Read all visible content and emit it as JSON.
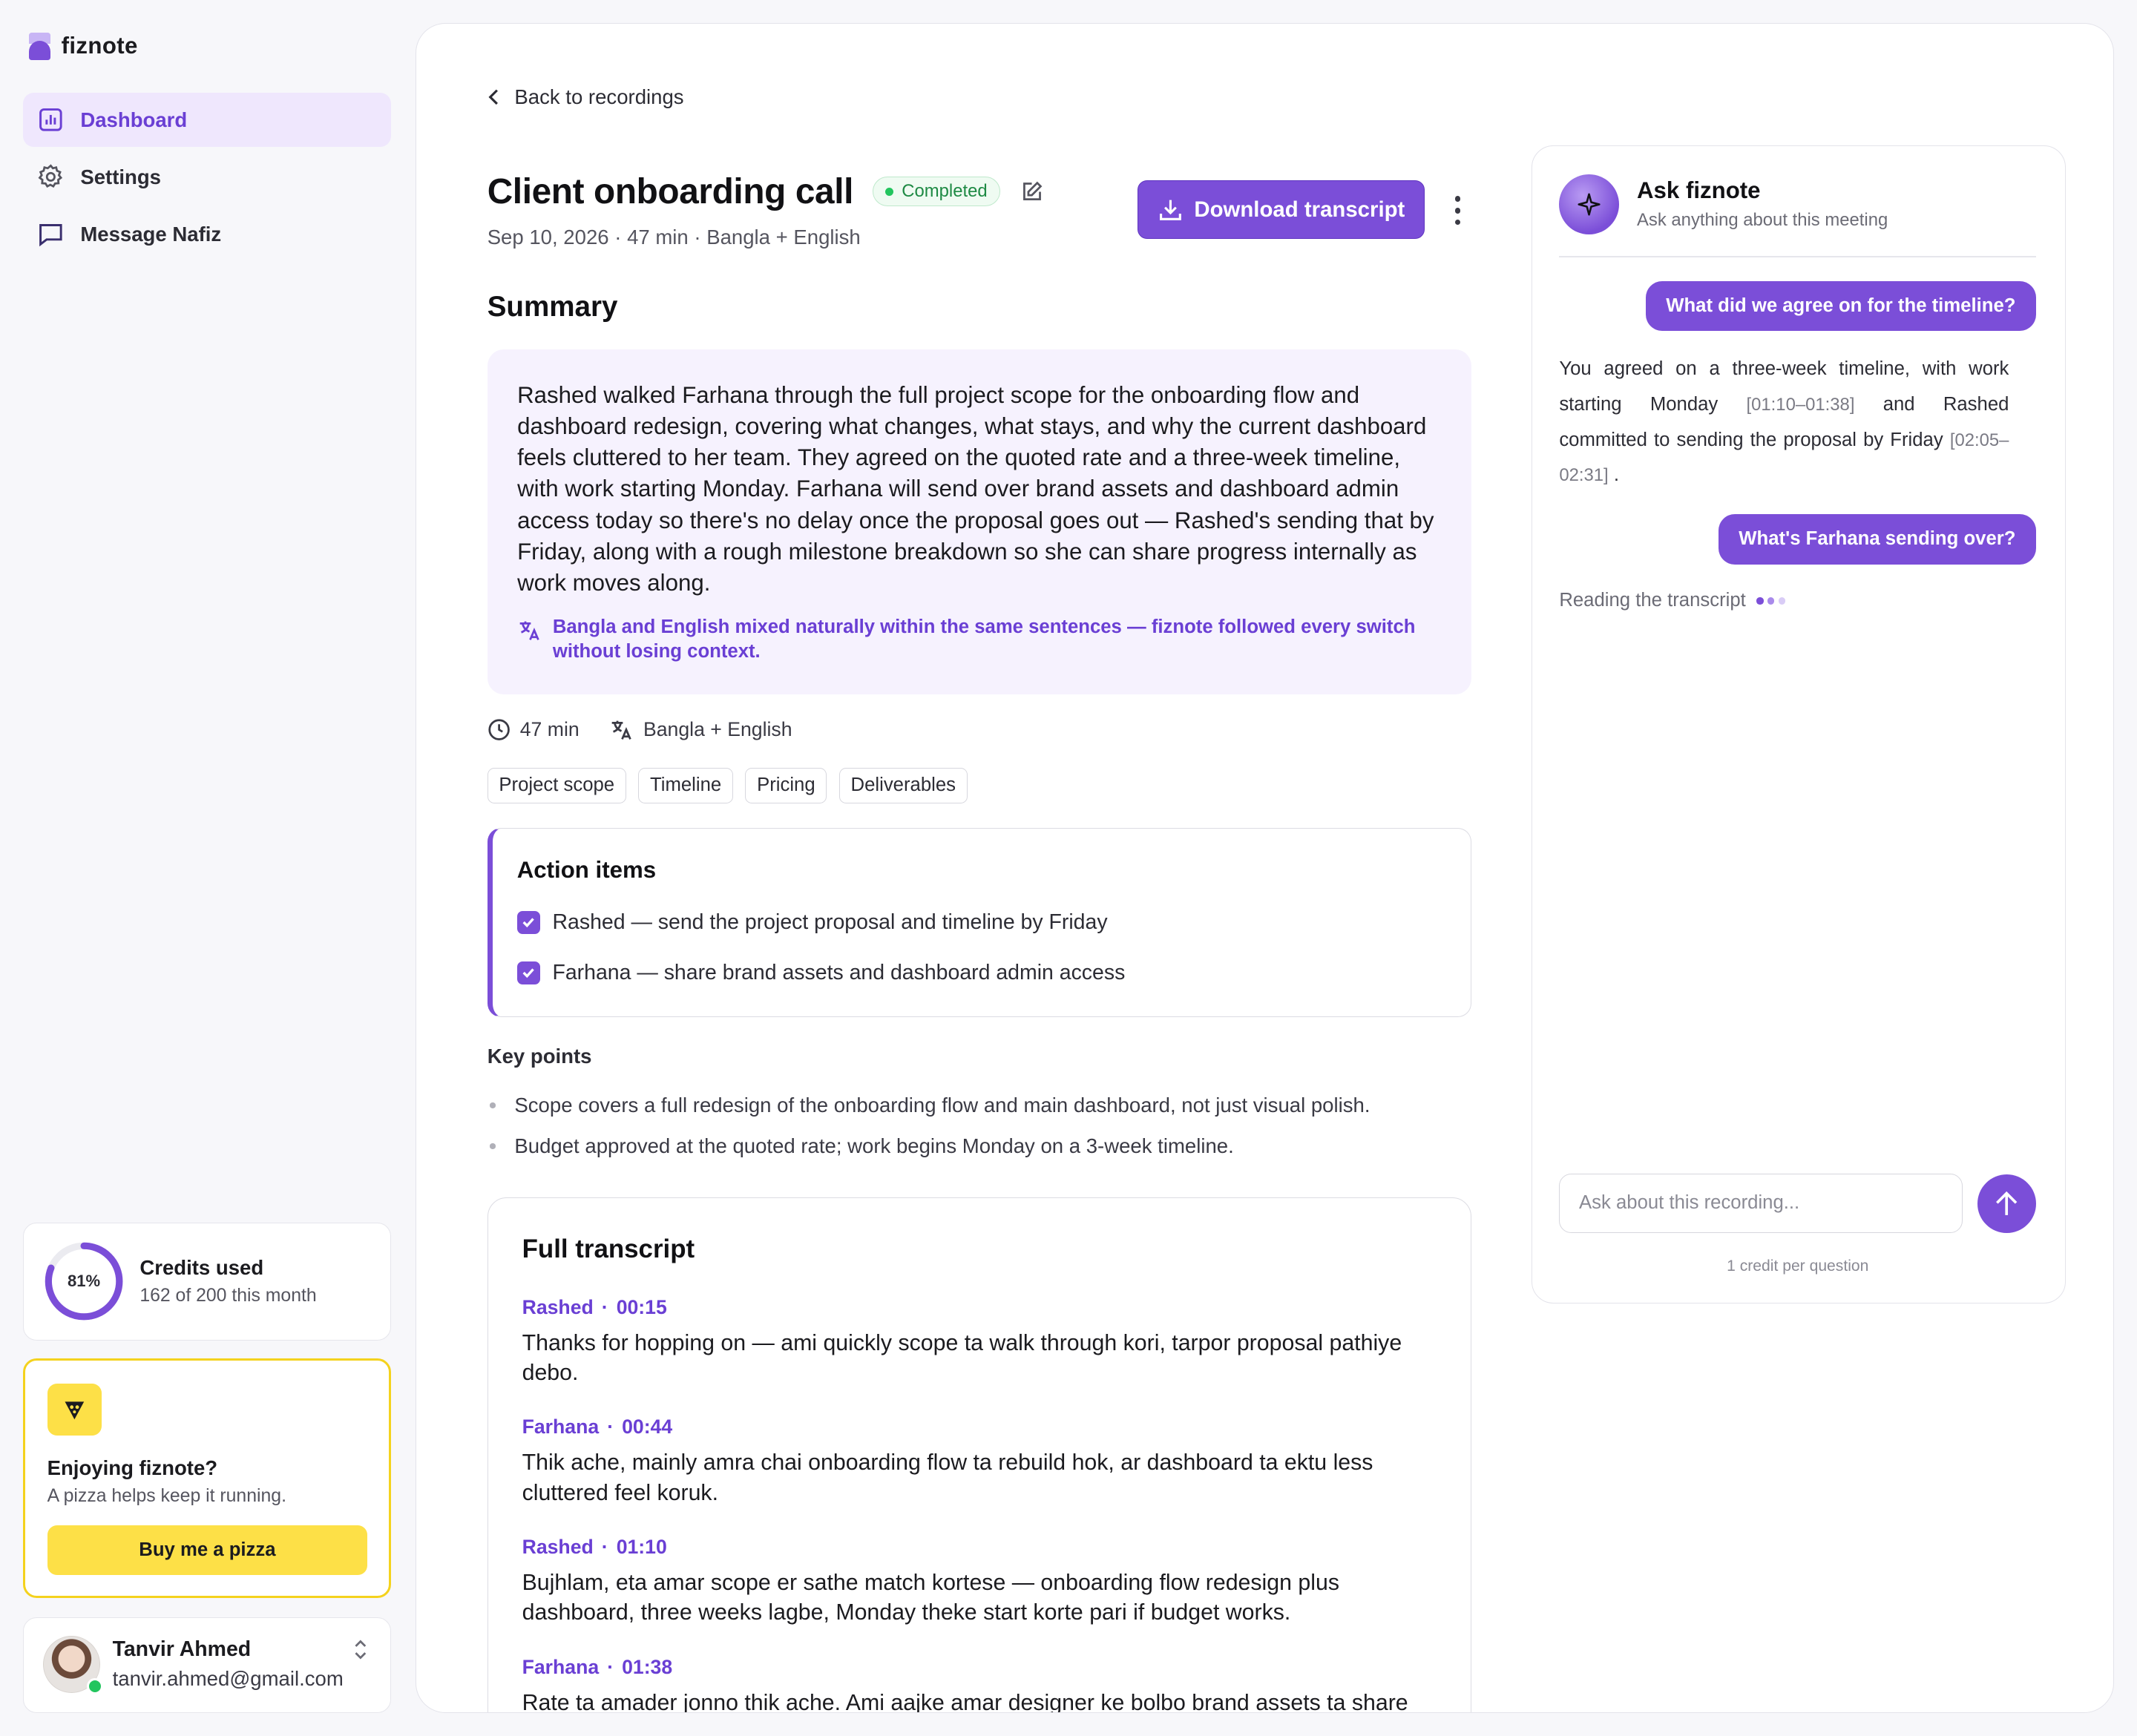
{
  "brand": {
    "name": "fiznote"
  },
  "sidebar": {
    "items": [
      {
        "label": "Dashboard",
        "icon": "chart-icon",
        "active": true
      },
      {
        "label": "Settings",
        "icon": "gear-icon",
        "active": false
      },
      {
        "label": "Message Nafiz",
        "icon": "message-icon",
        "active": false
      }
    ],
    "credits": {
      "percent_label": "81%",
      "percent": 0.81,
      "title": "Credits used",
      "sub": "162 of 200 this month"
    },
    "pizza": {
      "title": "Enjoying fiznote?",
      "sub": "A pizza helps keep it running.",
      "button": "Buy me a pizza"
    },
    "user": {
      "name": "Tanvir Ahmed",
      "email": "tanvir.ahmed@gmail.com"
    }
  },
  "colors": {
    "accent": "#7b4ed8",
    "accent_light": "#f6f2fe",
    "success": "#22c55e",
    "pizza": "#fde047"
  },
  "main": {
    "back_label": "Back to recordings",
    "title": "Client onboarding call",
    "status": "Completed",
    "meta": "Sep 10, 2026 · 47 min · Bangla + English",
    "download_label": "Download transcript",
    "summary_heading": "Summary",
    "summary_text": "Rashed walked Farhana through the full project scope for the onboarding flow and dashboard redesign, covering what changes, what stays, and why the current dashboard feels cluttered to her team. They agreed on the quoted rate and a three-week timeline, with work starting Monday. Farhana will send over brand assets and dashboard admin access today so there's no delay once the proposal goes out — Rashed's sending that by Friday, along with a rough milestone breakdown so she can share progress internally as work moves along.",
    "language_note": "Bangla and English mixed naturally within the same sentences — fiznote followed every switch without losing context.",
    "duration": "47 min",
    "languages": "Bangla + English",
    "tags": [
      "Project scope",
      "Timeline",
      "Pricing",
      "Deliverables"
    ],
    "action_items": {
      "title": "Action items",
      "items": [
        "Rashed — send the project proposal and timeline by Friday",
        "Farhana — share brand assets and dashboard admin access"
      ]
    },
    "key_points": {
      "title": "Key points",
      "items": [
        "Scope covers a full redesign of the onboarding flow and main dashboard, not just visual polish.",
        "Budget approved at the quoted rate; work begins Monday on a 3-week timeline."
      ]
    },
    "transcript": {
      "title": "Full transcript",
      "entries": [
        {
          "speaker": "Rashed",
          "time": "00:15",
          "text": "Thanks for hopping on — ami quickly scope ta walk through kori, tarpor proposal pathiye debo."
        },
        {
          "speaker": "Farhana",
          "time": "00:44",
          "text": "Thik ache, mainly amra chai onboarding flow ta rebuild hok, ar dashboard ta ektu less cluttered feel koruk."
        },
        {
          "speaker": "Rashed",
          "time": "01:10",
          "text": "Bujhlam, eta amar scope er sathe match kortese — onboarding flow redesign plus dashboard, three weeks lagbe, Monday theke start korte pari if budget works."
        },
        {
          "speaker": "Farhana",
          "time": "01:38",
          "text": "Rate ta amader jonno thik ache. Ami aajke amar designer ke bolbo brand assets ta share"
        }
      ]
    }
  },
  "ask": {
    "title": "Ask fiznote",
    "sub": "Ask anything about this meeting",
    "q1": "What did we agree on for the timeline?",
    "a1_part1": "You agreed on a three-week timeline, with work starting Monday",
    "a1_ts1": "[01:10–01:38]",
    "a1_part2": "and Rashed committed to sending the proposal by Friday",
    "a1_ts2": "[02:05–02:31]",
    "a1_end": ".",
    "q2": "What's Farhana sending over?",
    "reading": "Reading the transcript",
    "placeholder": "Ask about this recording...",
    "credit_note": "1 credit per question"
  }
}
